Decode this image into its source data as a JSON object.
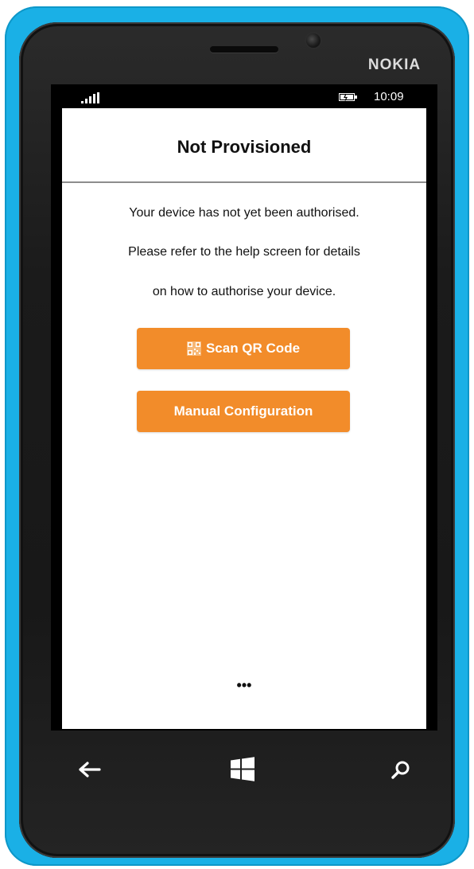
{
  "device": {
    "brand": "NOKIA"
  },
  "status_bar": {
    "time": "10:09"
  },
  "page": {
    "title": "Not Provisioned",
    "message_lines": [
      "Your device has not yet been authorised.",
      "Please refer to the help screen for details",
      "on how to authorise your device."
    ]
  },
  "actions": {
    "scan_label": "Scan QR Code",
    "manual_label": "Manual Configuration"
  },
  "app_bar": {
    "more_label": "•••"
  },
  "icons": {
    "signal": "signal-strength-icon",
    "battery": "battery-charging-icon",
    "qr": "qr-code-icon",
    "back": "back-arrow-icon",
    "home": "windows-logo-icon",
    "search": "search-icon"
  },
  "colors": {
    "phone_body": "#1ab0e6",
    "button_accent": "#f28c2a",
    "button_text": "#ffffff",
    "screen_background": "#ffffff"
  }
}
